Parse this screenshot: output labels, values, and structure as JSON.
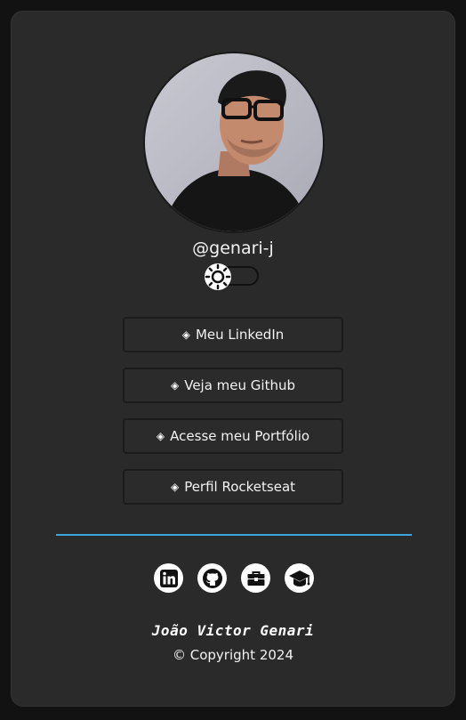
{
  "profile": {
    "handle": "@genari-j",
    "avatar_alt": "profile photo"
  },
  "theme_toggle": {
    "icon": "sun-icon",
    "state": "off"
  },
  "links": [
    {
      "glyph": "◈",
      "label": "Meu LinkedIn"
    },
    {
      "glyph": "◈",
      "label": "Veja meu Github"
    },
    {
      "glyph": "◈",
      "label": "Acesse meu Portfólio"
    },
    {
      "glyph": "◈",
      "label": "Perfil Rocketseat"
    }
  ],
  "divider_color": "#3aa6dd",
  "socials": [
    {
      "icon": "linkedin-icon"
    },
    {
      "icon": "github-icon"
    },
    {
      "icon": "toolbox-icon"
    },
    {
      "icon": "graduation-cap-icon"
    }
  ],
  "footer": {
    "name": "João Victor Genari",
    "copyright": "© Copyright 2024"
  }
}
